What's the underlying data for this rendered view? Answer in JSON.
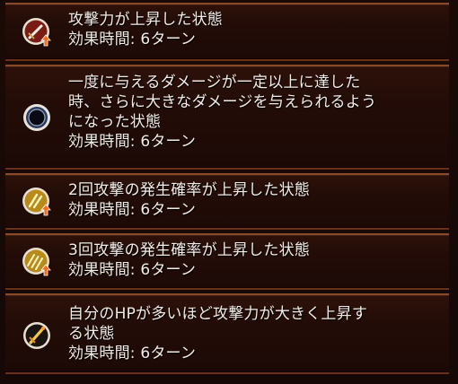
{
  "effects": [
    {
      "icon": "attack-up-sword-icon",
      "lines": [
        "攻撃力が上昇した状態",
        "効果時間: 6ターン"
      ]
    },
    {
      "icon": "dark-ring-icon",
      "lines": [
        "一度に与えるダメージが一定以上に達した",
        "時、さらに大きなダメージを与えられるよう",
        "になった状態",
        "効果時間: 6ターン"
      ]
    },
    {
      "icon": "double-attack-up-icon",
      "lines": [
        "2回攻撃の発生確率が上昇した状態",
        "効果時間: 6ターン"
      ]
    },
    {
      "icon": "triple-attack-up-icon",
      "lines": [
        "3回攻撃の発生確率が上昇した状態",
        "効果時間: 6ターン"
      ]
    },
    {
      "icon": "hp-attack-up-sword-icon",
      "lines": [
        "自分のHPが多いほど攻撃力が大きく上昇す",
        "る状態",
        "効果時間: 6ターン"
      ]
    }
  ]
}
